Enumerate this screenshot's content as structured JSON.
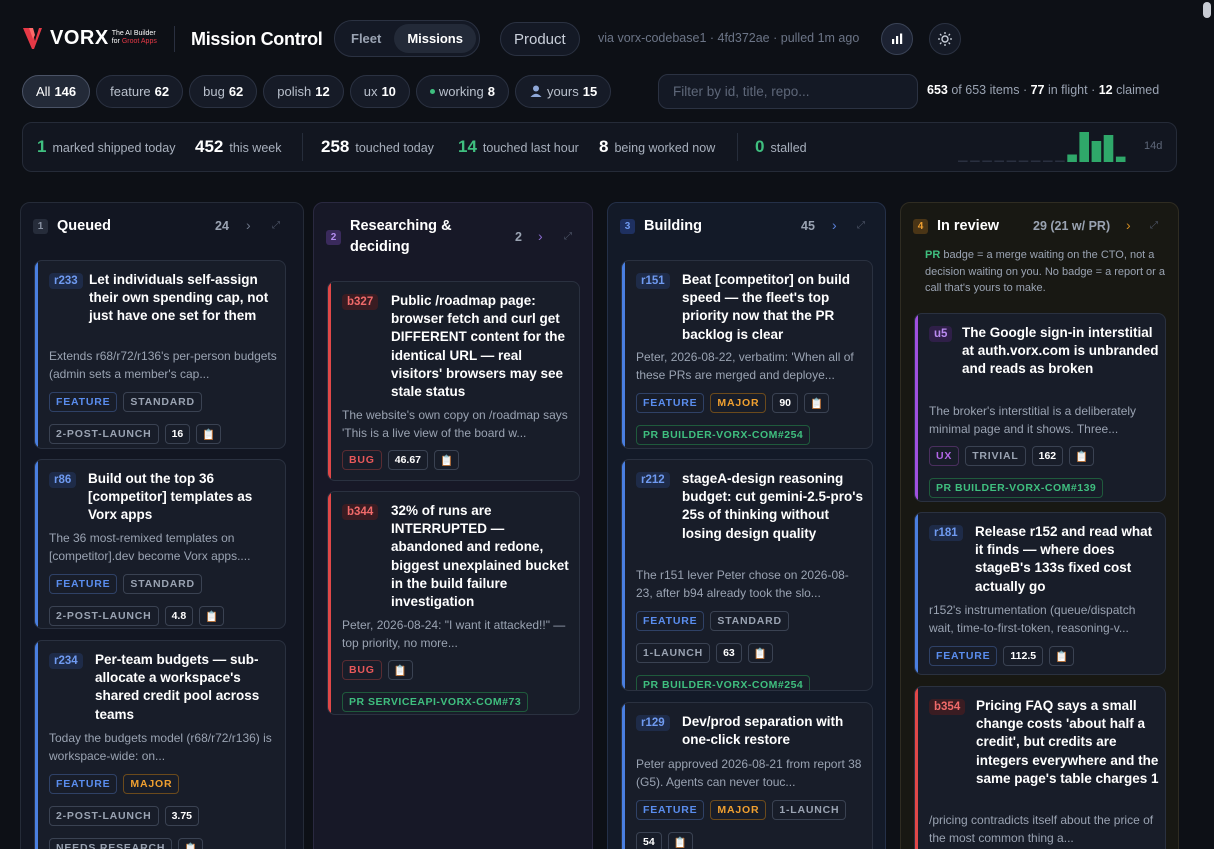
{
  "brand": {
    "name": "VORX",
    "tag_line1": "The AI Builder",
    "tag_line2_prefix": "for",
    "tag_line2_rest": "Groot Apps",
    "accent": "#e63946"
  },
  "header": {
    "title": "Mission Control",
    "tabs": [
      "Fleet",
      "Missions"
    ],
    "active_tab": "Missions",
    "product_label": "Product",
    "via_text": "via vorx-codebase1 · 4fd372ae · pulled 1m ago",
    "icons": [
      "bar-chart-icon",
      "sun-icon"
    ]
  },
  "filters": {
    "chips": [
      {
        "label": "All",
        "count": "146",
        "active": true
      },
      {
        "label": "feature",
        "count": "62"
      },
      {
        "label": "bug",
        "count": "62"
      },
      {
        "label": "polish",
        "count": "12"
      },
      {
        "label": "ux",
        "count": "10"
      },
      {
        "label": "working",
        "count": "8",
        "dot": true
      },
      {
        "label": "yours",
        "count": "15",
        "icon": "person-icon"
      }
    ],
    "search_placeholder": "Filter by id, title, repo...",
    "counts": {
      "shown": "653",
      "of_text": "of",
      "total": "653",
      "items_text": "items ·",
      "in_flight": "77",
      "in_flight_text": "in flight ·",
      "claimed": "12",
      "claimed_text": "claimed"
    }
  },
  "stats": {
    "shipped_today": {
      "num": "1",
      "label": "marked shipped today"
    },
    "this_week": {
      "num": "452",
      "label": "this week"
    },
    "touched_today": {
      "num": "258",
      "label": "touched today"
    },
    "touched_last_hour": {
      "num": "14",
      "label": "touched last hour"
    },
    "being_worked": {
      "num": "8",
      "label": "being worked now"
    },
    "stalled": {
      "num": "0",
      "label": "stalled"
    },
    "spark_label": "14d",
    "spark_values": [
      0,
      0,
      0,
      0,
      0,
      0,
      0,
      0,
      0,
      0.25,
      1,
      0.7,
      0.9,
      0.18
    ]
  },
  "columns": [
    {
      "num": "1",
      "title": "Queued",
      "count": "24",
      "cards": [
        {
          "id": "r233",
          "title": "Let individuals self-assign their own spending cap, not just have one set for them",
          "desc": "Extends r68/r72/r136's per-person budgets (admin sets a member's cap...",
          "tags": [
            "FEATURE",
            "STANDARD",
            "|",
            "2-POST-LAUNCH",
            "16",
            "📋"
          ]
        },
        {
          "id": "r86",
          "title": "Build out the top 36 [competitor] templates as Vorx apps",
          "desc": "The 36 most-remixed templates on [competitor].dev become Vorx apps....",
          "tags": [
            "FEATURE",
            "STANDARD",
            "|",
            "2-POST-LAUNCH",
            "4.8",
            "📋"
          ]
        },
        {
          "id": "r234",
          "title": "Per-team budgets — sub-allocate a workspace's shared credit pool across teams",
          "desc": "Today the budgets model (r68/r72/r136) is workspace-wide: on...",
          "tags": [
            "FEATURE",
            "MAJOR",
            "|",
            "2-POST-LAUNCH",
            "3.75",
            "|",
            "NEEDS RESEARCH",
            "📋"
          ]
        }
      ]
    },
    {
      "num": "2",
      "title": "Researching & deciding",
      "count": "2",
      "cards": [
        {
          "id": "b327",
          "title": "Public /roadmap page: browser fetch and curl get DIFFERENT content for the identical URL — real visitors' browsers may see stale status",
          "desc": "The website's own copy on /roadmap says 'This is a live view of the board w...",
          "tags": [
            "BUG",
            "46.67",
            "📋"
          ]
        },
        {
          "id": "b344",
          "title": "32% of runs are INTERRUPTED — abandoned and redone, biggest unexplained bucket in the build failure investigation",
          "desc": "Peter, 2026-08-24: \"I want it attacked!!\" — top priority, no more...",
          "tags": [
            "BUG",
            "📋",
            "|",
            "PR SERVICEAPI-VORX-COM#73"
          ]
        }
      ]
    },
    {
      "num": "3",
      "title": "Building",
      "count": "45",
      "cards": [
        {
          "id": "r151",
          "title": "Beat [competitor] on build speed — the fleet's top priority now that the PR backlog is clear",
          "desc": "Peter, 2026-08-22, verbatim: 'When all of these PRs are merged and deploye...",
          "tags": [
            "FEATURE",
            "MAJOR",
            "90",
            "📋",
            "|",
            "PR BUILDER-VORX-COM#254"
          ]
        },
        {
          "id": "r212",
          "title": "stageA-design reasoning budget: cut gemini-2.5-pro's 25s of thinking without losing design quality",
          "desc": "The r151 lever Peter chose on 2026-08-23, after b94 already took the slo...",
          "tags": [
            "FEATURE",
            "STANDARD",
            "|",
            "1-LAUNCH",
            "63",
            "📋",
            "|",
            "PR BUILDER-VORX-COM#254"
          ]
        },
        {
          "id": "r129",
          "title": "Dev/prod separation with one-click restore",
          "desc": "Peter approved 2026-08-21 from report 38 (G5). Agents can never touc...",
          "tags": [
            "FEATURE",
            "MAJOR",
            "1-LAUNCH",
            "|",
            "54",
            "📋"
          ]
        }
      ]
    },
    {
      "num": "4",
      "title": "In review",
      "count": "29 (21 w/ PR)",
      "note_pr": "PR",
      "note_text": "badge = a merge waiting on the CTO, not a decision waiting on you. No badge = a report or a call that's yours to make.",
      "cards": [
        {
          "id": "u5",
          "title": "The Google sign-in interstitial at auth.vorx.com is unbranded and reads as broken",
          "desc": "The broker's interstitial is a deliberately minimal page and it shows. Three...",
          "tags": [
            "UX",
            "TRIVIAL",
            "162",
            "📋",
            "|",
            "PR BUILDER-VORX-COM#139"
          ]
        },
        {
          "id": "r181",
          "title": "Release r152 and read what it finds — where does stageB's 133s fixed cost actually go",
          "desc": "r152's instrumentation (queue/dispatch wait, time-to-first-token, reasoning-v...",
          "tags": [
            "FEATURE",
            "112.5",
            "📋"
          ]
        },
        {
          "id": "b354",
          "title": "Pricing FAQ says a small change costs 'about half a credit', but credits are integers everywhere and the same page's table charges 1",
          "desc": "/pricing contradicts itself about the price of the most common thing a...",
          "tags": []
        }
      ]
    }
  ],
  "colors": {
    "bg": "#0d1016",
    "feature": "#5a8dee",
    "bug": "#e8585a",
    "ux": "#b266e8",
    "major": "#f0a030",
    "green": "#3fbf7f"
  }
}
